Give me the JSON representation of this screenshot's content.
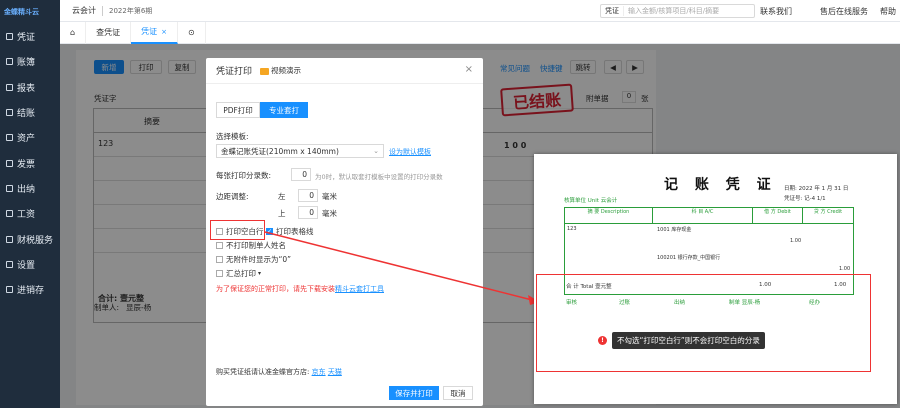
{
  "app": {
    "logo": "金蝶精斗云",
    "name": "云会计",
    "period": "2022年第6期"
  },
  "sidebar": {
    "items": [
      {
        "label": "凭证"
      },
      {
        "label": "账簿"
      },
      {
        "label": "报表"
      },
      {
        "label": "结账"
      },
      {
        "label": "资产"
      },
      {
        "label": "发票"
      },
      {
        "label": "出纳"
      },
      {
        "label": "工资"
      },
      {
        "label": "财税服务"
      },
      {
        "label": "设置"
      },
      {
        "label": "进销存"
      }
    ]
  },
  "topbar": {
    "search_type": "凭证",
    "search_placeholder": "输入金额/核算项目/科目/摘要",
    "contact": "联系我们",
    "service": "售后在线服务",
    "help": "帮助"
  },
  "tabs": [
    {
      "label": "查凭证"
    },
    {
      "label": "凭证"
    }
  ],
  "toolbar": {
    "new": "新增",
    "print": "打印",
    "copy": "复制",
    "help_link": "常见问题",
    "shortcut": "快捷键",
    "jump": "跳转"
  },
  "voucher": {
    "type_label": "凭证字",
    "stamp": "已结账",
    "attach_label": "附单据",
    "attach_value": "0",
    "attach_unit": "张",
    "col_summary": "摘要",
    "row_summary": "123",
    "debit_digits": "1 0 0",
    "total_label": "合计: 壹元整",
    "maker_label": "制单人:",
    "maker": "显辰-杨"
  },
  "dialog": {
    "title": "凭证打印",
    "video": "视频演示",
    "tabs": [
      "PDF打印",
      "专业套打"
    ],
    "template_label": "选择模板:",
    "template_value": "金蝶记账凭证(210mm x 140mm)",
    "template_default": "设为默认模板",
    "rows_label": "每张打印分录数:",
    "rows_value": "0",
    "rows_hint": "为0时，默认取套打模板中设置的打印分录数",
    "margin_label": "边距调整:",
    "left_label": "左",
    "left_value": "0",
    "top_label": "上",
    "top_value": "0",
    "unit": "毫米",
    "opt_blank": "打印空白行",
    "opt_table_line": "打印表格线",
    "opt_no_maker": "不打印制单人姓名",
    "opt_zero": "无附件时显示为“0”",
    "opt_summary": "汇总打印",
    "warn": "为了保证您的正常打印，请先下载安装",
    "warn_link": "精斗云套打工具",
    "shop": "购买凭证纸请认准金蝶官方店:",
    "shop_jd": "京东",
    "shop_tmall": "天猫",
    "save_print": "保存并打印",
    "cancel": "取消"
  },
  "preview": {
    "title": "记 账 凭 证",
    "unit": "核算单位 Unit  云会计",
    "date": "日期: 2022 年 1 月 31 日",
    "number": "凭证号: 记-4      1/1",
    "headers": [
      "摘 要 Description",
      "科 目 A/C",
      "借 方 Debit",
      "贷 方 Credit"
    ],
    "row1": {
      "desc": "123",
      "ac": "1001 库存现金",
      "debit": "1.00"
    },
    "row2": {
      "ac": "100201 银行存款_中国银行",
      "credit": "1.00"
    },
    "total": "合 计 Total   壹元整",
    "total_debit": "1.00",
    "total_credit": "1.00",
    "footer": [
      "审核",
      "过账",
      "出纳",
      "制单 显辰-杨",
      "经办"
    ],
    "callout": "不勾选“打印空白行”则不会打印空白的分录"
  }
}
